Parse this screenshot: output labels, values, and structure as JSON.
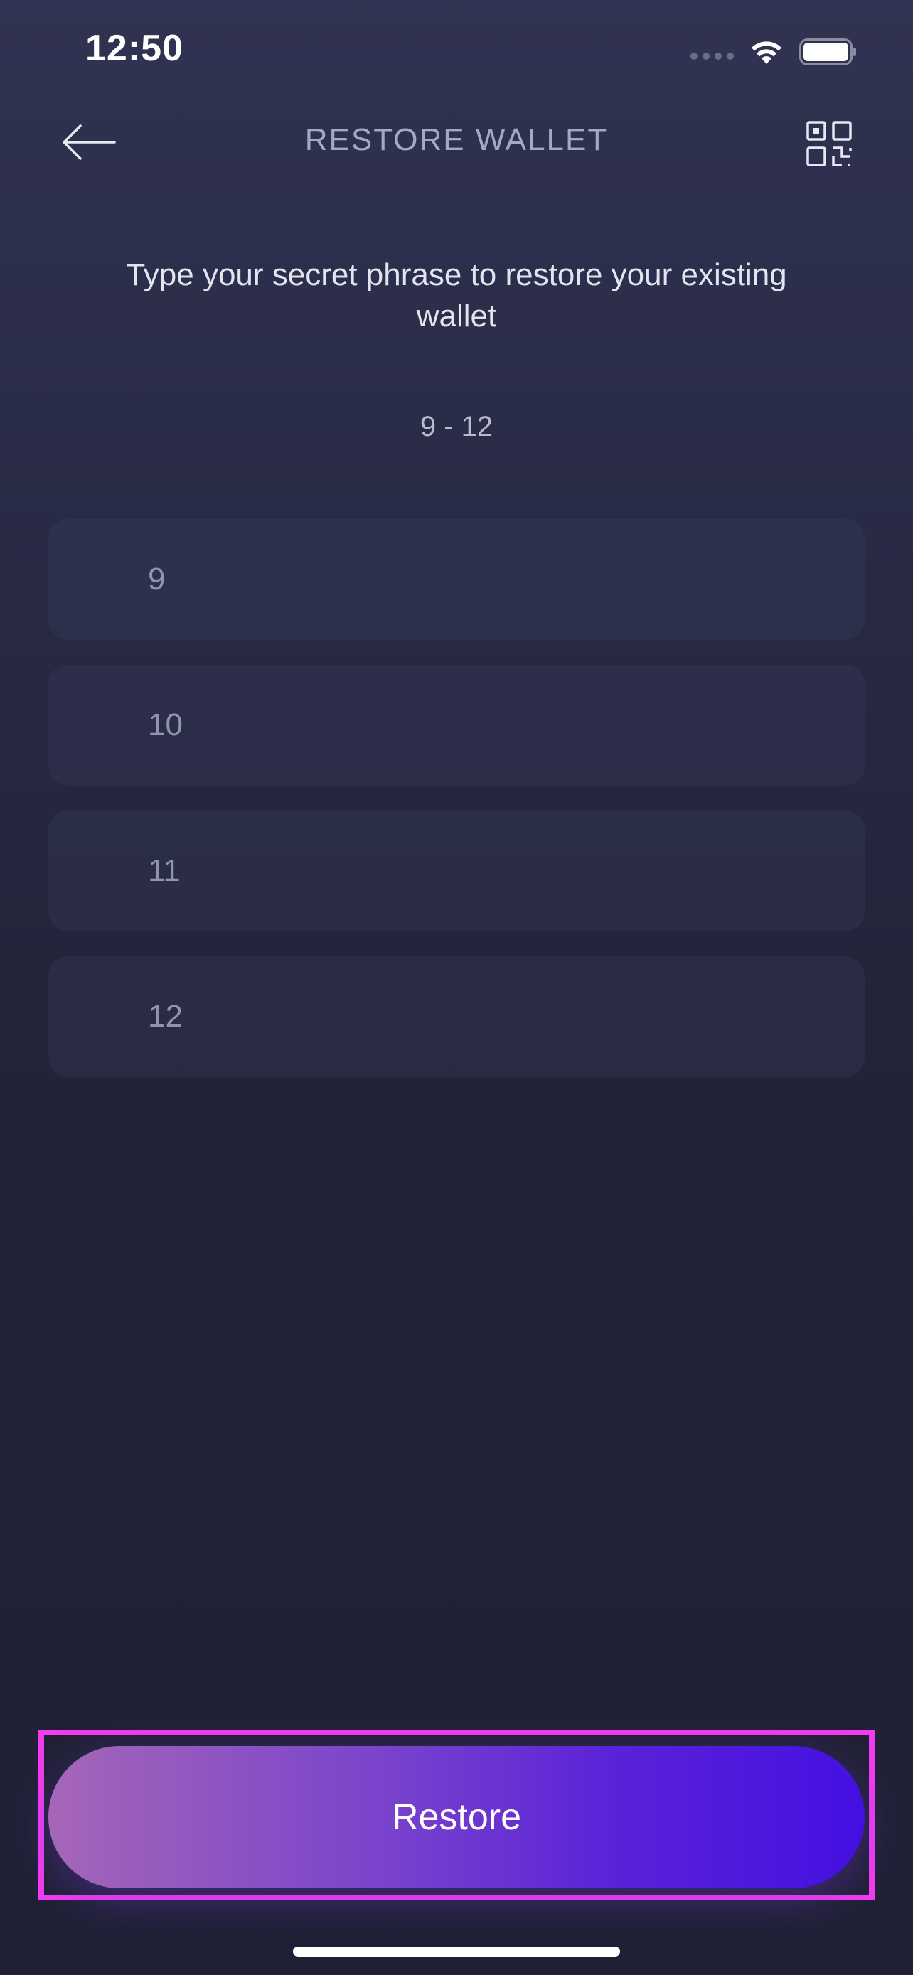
{
  "status_bar": {
    "time": "12:50",
    "icons": [
      "signal-dots-icon",
      "wifi-icon",
      "battery-icon"
    ]
  },
  "header": {
    "back_icon": "arrow-left-icon",
    "title": "RESTORE WALLET",
    "qr_icon": "qr-code-icon"
  },
  "instruction": "Type your secret phrase to restore your existing wallet",
  "range_label": "9 - 12",
  "word_fields": [
    {
      "number": "9",
      "value": ""
    },
    {
      "number": "10",
      "value": ""
    },
    {
      "number": "11",
      "value": ""
    },
    {
      "number": "12",
      "value": ""
    }
  ],
  "restore_button": {
    "label": "Restore"
  },
  "colors": {
    "background_top": "#303351",
    "background_bottom": "#1f2034",
    "title": "#a3a8c6",
    "button_gradient_start": "#a666b8",
    "button_gradient_end": "#4410e2",
    "highlight": "#f23cf0"
  }
}
